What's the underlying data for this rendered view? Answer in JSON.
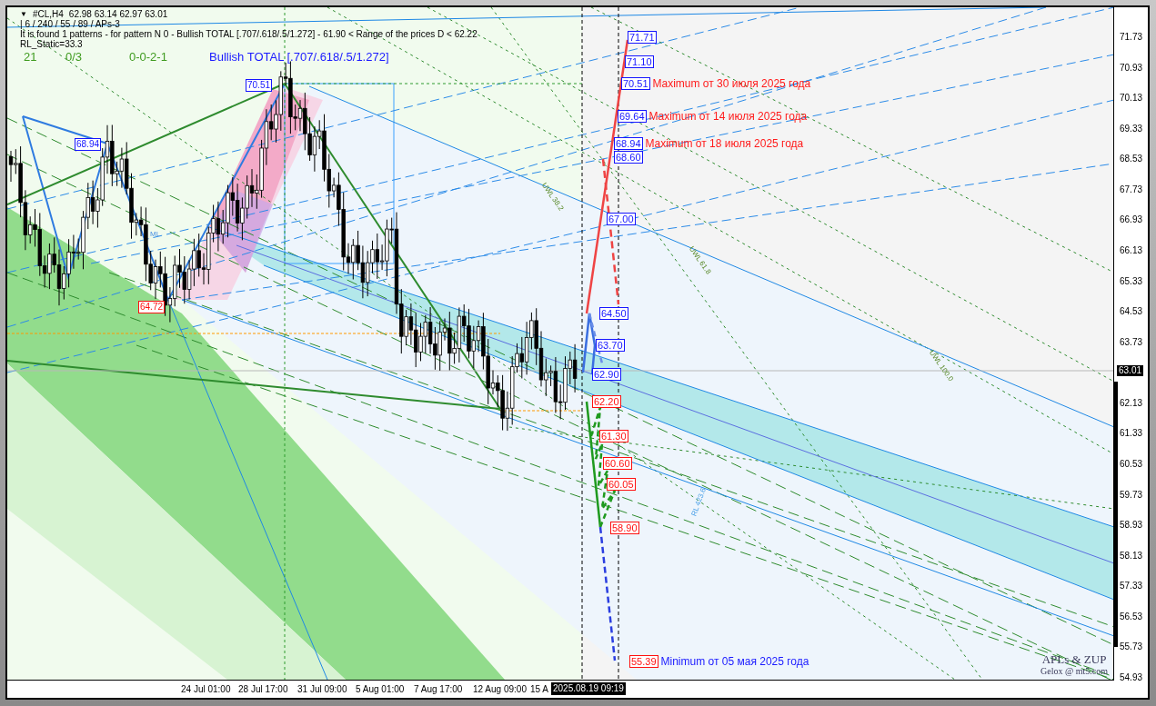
{
  "header": {
    "caret": "▼",
    "symbol": "#CL,H4",
    "ohlc": "62.98 63.14 62.97 63.01",
    "settings": "| 6 / 240 / 55 / 89 / APs-3",
    "message": "It is found 1 patterns  -  for pattern N 0 - Bullish TOTAL [.707/.618/.5/1.272] - 61.90 < Range of the prices D < 62.22",
    "static": "RL_Static=33.3",
    "stats": [
      "21",
      "0/3",
      "0-0-2-1"
    ],
    "pattern": "Bullish TOTAL [.707/.618/.5/1.272]"
  },
  "pattern_points": [
    {
      "price": "70.51",
      "kind": "high"
    },
    {
      "price": "68.94",
      "kind": "high"
    },
    {
      "price": "64.72",
      "kind": "low"
    }
  ],
  "line_labels": [
    "ML",
    "UWL 38.2",
    "UWL 61.8",
    "UWL 100.0",
    "RL 423.6"
  ],
  "targets": [
    {
      "price": "71.71",
      "kind": "up"
    },
    {
      "price": "71.10",
      "kind": "up"
    },
    {
      "price": "70.51",
      "kind": "up",
      "note": "Maximum от 30 июля 2025 года"
    },
    {
      "price": "69.64",
      "kind": "up",
      "note": "Maximum от 14 июля 2025 года"
    },
    {
      "price": "68.94",
      "kind": "up",
      "note": "Maximum от 18 июля 2025 года"
    },
    {
      "price": "68.60",
      "kind": "up"
    },
    {
      "price": "67.00",
      "kind": "up"
    },
    {
      "price": "64.50",
      "kind": "up"
    },
    {
      "price": "63.70",
      "kind": "up"
    },
    {
      "price": "62.90",
      "kind": "up"
    },
    {
      "price": "62.20",
      "kind": "down"
    },
    {
      "price": "61.30",
      "kind": "down"
    },
    {
      "price": "60.60",
      "kind": "down"
    },
    {
      "price": "60.05",
      "kind": "down"
    },
    {
      "price": "58.90",
      "kind": "down"
    },
    {
      "price": "55.39",
      "kind": "down",
      "note": "Minimum от 05 мая 2025 года"
    }
  ],
  "signature": {
    "title": "APLs & ZUP",
    "subtitle": "Gelox @ mt5.com"
  },
  "price_axis": {
    "labels": [
      "71.73",
      "70.93",
      "70.13",
      "69.33",
      "68.53",
      "67.73",
      "66.93",
      "66.13",
      "65.33",
      "64.53",
      "63.73",
      "62.13",
      "61.33",
      "60.53",
      "59.73",
      "58.93",
      "58.13",
      "57.33",
      "56.53",
      "55.73",
      "54.93"
    ],
    "current": "63.01"
  },
  "time_axis": {
    "labels": [
      "24 Jul 01:00",
      "28 Jul 17:00",
      "31 Jul 09:00",
      "5 Aug 01:00",
      "7 Aug 17:00",
      "12 Aug 09:00",
      "15 A"
    ],
    "cursor": "2025.08.19 09:19"
  }
}
